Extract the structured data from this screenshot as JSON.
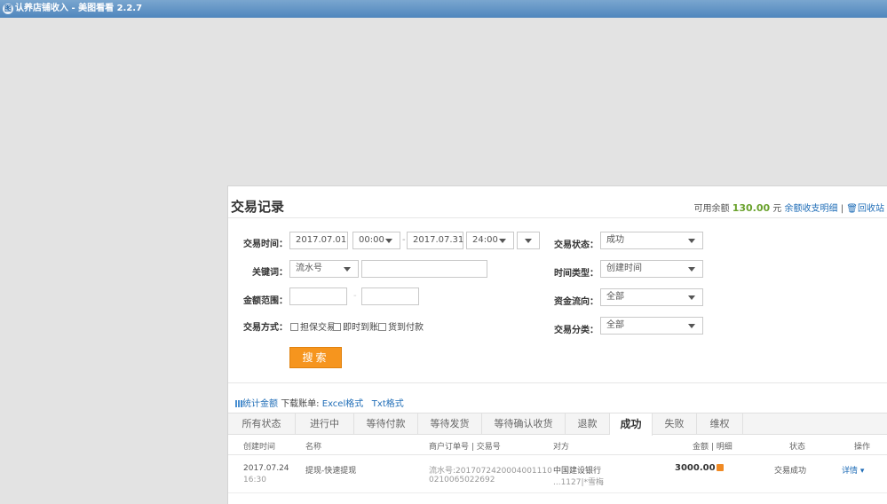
{
  "window": {
    "title": "认养店铺收入 - 美图看看 2.2.7",
    "icon_glyph": "图"
  },
  "panel": {
    "title": "交易记录",
    "balance_prefix": "可用余额",
    "balance_amount": "130.00",
    "balance_unit": "元",
    "balance_link": "余额收支明细",
    "balance_divider": "|",
    "recycle_link": "回收站"
  },
  "form": {
    "time_label": "交易时间：",
    "start_date": "2017.07.01",
    "start_time": "00:00",
    "range_sep": "-",
    "end_date": "2017.07.31",
    "end_time": "24:00",
    "keyword_label": "关键词：",
    "keyword_type": "流水号",
    "keyword_value": "",
    "amount_label": "金额范围：",
    "amount_from": "",
    "amount_sep": "-",
    "amount_to": "",
    "mode_label": "交易方式：",
    "mode_options": [
      "担保交易",
      "即时到账",
      "货到付款"
    ],
    "status_label": "交易状态：",
    "status_value": "成功",
    "timetype_label": "时间类型：",
    "timetype_value": "创建时间",
    "flow_label": "资金流向：",
    "flow_value": "全部",
    "category_label": "交易分类：",
    "category_value": "全部",
    "search_button": "搜索"
  },
  "stats": {
    "stat_link": "统计金额",
    "download_label": "下载账单:",
    "excel": "Excel格式",
    "txt": "Txt格式"
  },
  "tabs": [
    "所有状态",
    "进行中",
    "等待付款",
    "等待发货",
    "等待确认收货",
    "退款",
    "成功",
    "失败",
    "维权"
  ],
  "active_tab": "成功",
  "columns": {
    "created": "创建时间",
    "name": "名称",
    "order": "商户订单号 | 交易号",
    "counterparty": "对方",
    "amount": "金额 | 明细",
    "status": "状态",
    "action": "操作"
  },
  "rows": [
    {
      "date": "2017.07.24",
      "time": "16:30",
      "name": "提现-快速提现",
      "serial_line1": "流水号:2017072420004001110",
      "serial_line2": "0210065022692",
      "counterparty_line1": "中国建设银行",
      "counterparty_line2": "...1127|*雪梅",
      "amount": "3000.00",
      "status": "交易成功",
      "action": "详情 ▾"
    }
  ],
  "colors": {
    "accent": "#f6951e",
    "link": "#1f6db7",
    "balance": "#6aa22d"
  }
}
